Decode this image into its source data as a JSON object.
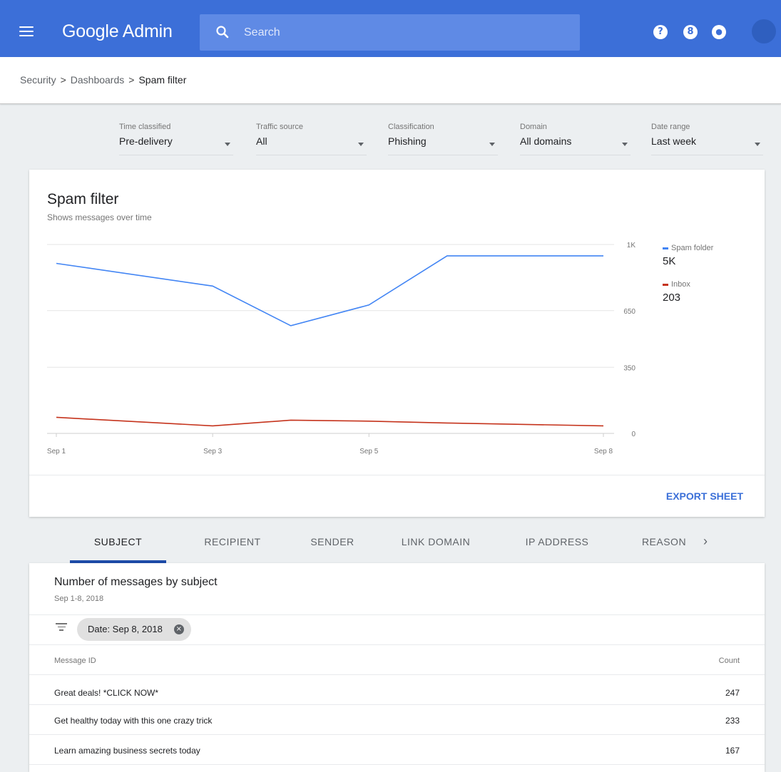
{
  "app": {
    "title": "Google Admin"
  },
  "search": {
    "placeholder": "Search"
  },
  "header_icons": {
    "help": "?",
    "apps": "8",
    "notifications": "●"
  },
  "breadcrumb": {
    "items": [
      "Security",
      "Dashboards",
      "Spam filter"
    ],
    "separator": ">"
  },
  "filters": [
    {
      "label": "Time classified",
      "value": "Pre-delivery"
    },
    {
      "label": "Traffic source",
      "value": "All"
    },
    {
      "label": "Classification",
      "value": "Phishing"
    },
    {
      "label": "Domain",
      "value": "All domains"
    },
    {
      "label": "Date range",
      "value": "Last week"
    }
  ],
  "chart": {
    "title": "Spam filter",
    "subtitle": "Shows messages over time",
    "export_label": "EXPORT SHEET"
  },
  "chart_data": {
    "type": "line",
    "x": [
      "Sep 1",
      "Sep 3",
      "Sep 4",
      "Sep 5",
      "Sep 6",
      "Sep 8"
    ],
    "x_tick_labels": [
      "Sep 1",
      "Sep 3",
      "Sep 5",
      "Sep 8"
    ],
    "y_tick_labels": [
      "1K",
      "650",
      "350",
      "0"
    ],
    "ylim": [
      0,
      1000
    ],
    "grid": true,
    "legend_position": "right",
    "series": [
      {
        "name": "Spam folder",
        "total": "5K",
        "color": "#4285f4",
        "values": [
          900,
          780,
          570,
          680,
          940,
          940
        ]
      },
      {
        "name": "Inbox",
        "total": "203",
        "color": "#c5331c",
        "values": [
          85,
          40,
          70,
          65,
          55,
          40
        ]
      }
    ]
  },
  "tabs": {
    "items": [
      "SUBJECT",
      "RECIPIENT",
      "SENDER",
      "LINK DOMAIN",
      "IP ADDRESS",
      "REASON"
    ],
    "active_index": 0,
    "next_arrow": "›"
  },
  "table": {
    "title": "Number of messages by subject",
    "subtitle": "Sep 1-8, 2018",
    "filter_chip": "Date: Sep 8, 2018",
    "columns": [
      "Message ID",
      "Count"
    ],
    "rows": [
      {
        "message": "Great deals! *CLICK NOW*",
        "count": "247"
      },
      {
        "message": "Get healthy today with this one crazy trick",
        "count": "233"
      },
      {
        "message": "Learn amazing business secrets today",
        "count": "167"
      }
    ]
  }
}
